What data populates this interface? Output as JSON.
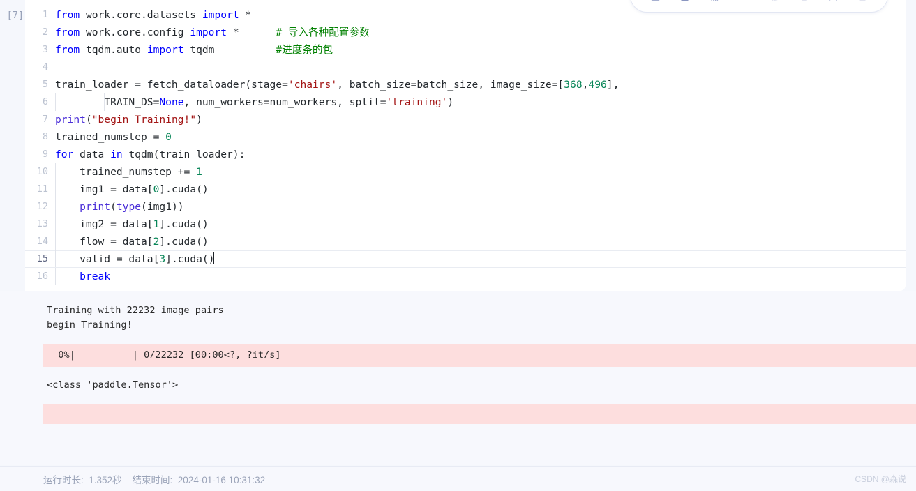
{
  "toolbar": {
    "buttons": [
      {
        "name": "merge-cell-above-icon",
        "label": "Merge cell above"
      },
      {
        "name": "move-cell-down-icon",
        "label": "Move cell down"
      },
      {
        "name": "insert-code-cell-icon",
        "label": "Insert code cell"
      },
      {
        "name": "insert-markdown-cell-icon",
        "label": "Insert markdown cell"
      },
      {
        "name": "copy-cell-icon",
        "label": "Copy cell"
      },
      {
        "name": "cut-cell-icon",
        "label": "Cut cell"
      },
      {
        "name": "bookmark-cell-icon",
        "label": "Bookmark cell"
      },
      {
        "name": "delete-cell-icon",
        "label": "Delete cell"
      }
    ]
  },
  "cell": {
    "execution_label": "[7]",
    "lines": [
      {
        "n": "1",
        "indent_guides": 0,
        "active": false
      },
      {
        "n": "2",
        "indent_guides": 0,
        "active": false
      },
      {
        "n": "3",
        "indent_guides": 0,
        "active": false
      },
      {
        "n": "4",
        "indent_guides": 0,
        "active": false
      },
      {
        "n": "5",
        "indent_guides": 0,
        "active": false
      },
      {
        "n": "6",
        "indent_guides": 3,
        "active": false
      },
      {
        "n": "7",
        "indent_guides": 0,
        "active": false
      },
      {
        "n": "8",
        "indent_guides": 0,
        "active": false
      },
      {
        "n": "9",
        "indent_guides": 0,
        "active": false
      },
      {
        "n": "10",
        "indent_guides": 1,
        "active": false
      },
      {
        "n": "11",
        "indent_guides": 1,
        "active": false
      },
      {
        "n": "12",
        "indent_guides": 1,
        "active": false
      },
      {
        "n": "13",
        "indent_guides": 1,
        "active": false
      },
      {
        "n": "14",
        "indent_guides": 1,
        "active": false
      },
      {
        "n": "15",
        "indent_guides": 1,
        "active": true
      },
      {
        "n": "16",
        "indent_guides": 1,
        "active": false
      }
    ],
    "source": {
      "l1_kw_from": "from",
      "l1_mod": " work.core.datasets ",
      "l1_kw_import": "import",
      "l1_star": " *",
      "l2_kw_from": "from",
      "l2_mod": " work.core.config ",
      "l2_kw_import": "import",
      "l2_star": " *",
      "l2_pad": "      ",
      "l2_comment": "# 导入各种配置参数",
      "l3_kw_from": "from",
      "l3_mod": " tqdm.auto ",
      "l3_kw_import": "import",
      "l3_star": " tqdm",
      "l3_pad": "          ",
      "l3_comment": "#进度条的包",
      "l4_blank": "",
      "l5_a": "train_loader = fetch_dataloader(stage=",
      "l5_str1": "'chairs'",
      "l5_b": ", batch_size=batch_size, image_size=[",
      "l5_n1": "368",
      "l5_c": ",",
      "l5_n2": "496",
      "l5_d": "],",
      "l6_a": "        TRAIN_DS=",
      "l6_kw_none": "None",
      "l6_b": ", num_workers=num_workers, split=",
      "l6_str1": "'training'",
      "l6_c": ")",
      "l7_bi": "print",
      "l7_a": "(",
      "l7_str": "\"begin Training!\"",
      "l7_b": ")",
      "l8_a": "trained_numstep = ",
      "l8_n": "0",
      "l9_kw_for": "for",
      "l9_a": " data ",
      "l9_kw_in": "in",
      "l9_b": " tqdm(train_loader):",
      "l10_a": "    trained_numstep += ",
      "l10_n": "1",
      "l11_a": "    img1 = data[",
      "l11_n": "0",
      "l11_b": "].cuda()",
      "l12_pad": "    ",
      "l12_bi1": "print",
      "l12_a": "(",
      "l12_bi2": "type",
      "l12_b": "(img1))",
      "l13_a": "    img2 = data[",
      "l13_n": "1",
      "l13_b": "].cuda()",
      "l14_a": "    flow = data[",
      "l14_n": "2",
      "l14_b": "].cuda()",
      "l15_a": "    valid = data[",
      "l15_n": "3",
      "l15_b": "].cuda()",
      "l16_pad": "    ",
      "l16_kw_break": "break"
    }
  },
  "output": {
    "stdout_1": "Training with 22232 image pairs\nbegin Training!",
    "stderr_progress": "  0%|          | 0/22232 [00:00<?, ?it/s]",
    "stdout_2": "<class 'paddle.Tensor'>",
    "stderr_empty": ""
  },
  "footer": {
    "duration_label": "运行时长:",
    "duration_value": "1.352秒",
    "endtime_label": "结束时间:",
    "endtime_value": "2024-01-16 10:31:32",
    "status_text": "运行时长:  1.352秒    结束时间:  2024-01-16 10:31:32",
    "watermark": "CSDN @森说"
  },
  "colors": {
    "keyword": "#0000ff",
    "builtin": "#4b2fd8",
    "string": "#a31515",
    "number": "#098658",
    "comment": "#008000",
    "stderr_bg": "#fddede",
    "output_bg": "#f7f8fd",
    "page_bg": "#f5f7fc"
  }
}
